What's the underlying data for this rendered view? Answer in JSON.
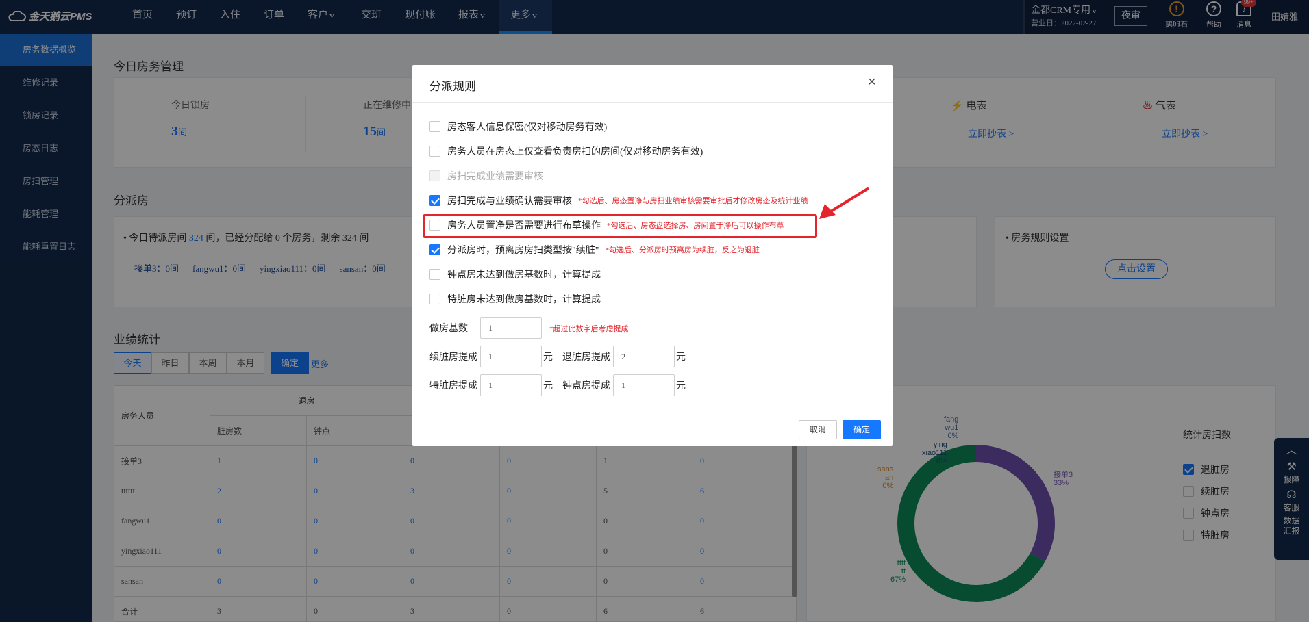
{
  "app": {
    "logo": "金天鹅云PMS"
  },
  "nav": [
    "首页",
    "预订",
    "入住",
    "订单",
    "客户",
    "交班",
    "现付账",
    "报表",
    "更多"
  ],
  "biz": {
    "store": "金都CRM专用",
    "date": "营业日：2022-02-27",
    "audit": "夜审",
    "icons": [
      {
        "label": "鹅卵石",
        "name": "warning-icon",
        "glyph": "!"
      },
      {
        "label": "帮助",
        "name": "help-icon",
        "glyph": "?"
      },
      {
        "label": "消息",
        "name": "bell-icon",
        "glyph": "♪"
      }
    ],
    "badge": "99+",
    "user": "田婧雅"
  },
  "sidebar": [
    "房务数据概览",
    "维修记录",
    "锁房记录",
    "房态日志",
    "房扫管理",
    "能耗管理",
    "能耗重置日志"
  ],
  "main": {
    "today_title": "今日房务管理",
    "kpi": [
      {
        "label": "今日锁房",
        "value": "3",
        "unit": "间"
      },
      {
        "label": "正在维修中",
        "value": "15",
        "unit": "间"
      }
    ],
    "meters": [
      {
        "label": "电表",
        "link": "立即抄表 >"
      },
      {
        "label": "气表",
        "link": "立即抄表 >"
      }
    ],
    "assign_title": "分派房",
    "assign_text": {
      "pre": "今日待派房间",
      "count": "324",
      "post": "间，已经分配给 0 个房务，剩余 324 间"
    },
    "staff": [
      "接单3：0间",
      "fangwu1：0间",
      "yingxiao111：0间",
      "sansan：0间"
    ],
    "rule_label": "房务规则设置",
    "rule_btn": "点击设置",
    "perf_title": "业绩统计",
    "tabs": [
      "今天",
      "昨日",
      "本周",
      "本月"
    ],
    "confirm": "确定",
    "more": "更多",
    "table": {
      "h_person": "房务人员",
      "h_group": "退房",
      "sub": [
        "脏房数",
        "钟点"
      ],
      "rows": [
        [
          "接单3",
          "1",
          "0",
          "0",
          "0",
          "1",
          "0"
        ],
        [
          "tttttt",
          "2",
          "0",
          "3",
          "0",
          "5",
          "6"
        ],
        [
          "fangwu1",
          "0",
          "0",
          "0",
          "0",
          "0",
          "0"
        ],
        [
          "yingxiao111",
          "0",
          "0",
          "0",
          "0",
          "0",
          "0"
        ],
        [
          "sansan",
          "0",
          "0",
          "0",
          "0",
          "0",
          "0"
        ],
        [
          "合计",
          "3",
          "0",
          "3",
          "0",
          "6",
          "6"
        ]
      ]
    },
    "legend_title": "统计房扫数",
    "legend": [
      {
        "label": "退脏房",
        "checked": true
      },
      {
        "label": "续脏房",
        "checked": false
      },
      {
        "label": "钟点房",
        "checked": false
      },
      {
        "label": "特脏房",
        "checked": false
      }
    ],
    "donut_labels": [
      {
        "text": "fang\nwu1\n0%",
        "color": "#4a6fa5"
      },
      {
        "text": "ying\nxiao111\n0%",
        "color": "#1f4e79"
      },
      {
        "text": "sans\nan\n0%",
        "color": "#d98b2b"
      },
      {
        "text": "接单3\n33%",
        "color": "#7a5cb8"
      },
      {
        "text": "tttt\ntt\n67%",
        "color": "#0e8a5a"
      }
    ]
  },
  "chart_data": {
    "type": "pie",
    "categories": [
      "接单3",
      "tttttt",
      "fangwu1",
      "yingxiao111",
      "sansan"
    ],
    "values": [
      33,
      67,
      0,
      0,
      0
    ],
    "colors": [
      "#6c4fae",
      "#0e8a5a",
      "#4a6fa5",
      "#1f4e79",
      "#d98b2b"
    ]
  },
  "floatbar": [
    "报障",
    "客服",
    "数据\n汇报"
  ],
  "modal": {
    "title": "分派规则",
    "close": "×",
    "options": [
      {
        "label": "房态客人信息保密(仅对移动房务有效)",
        "state": "off",
        "note": ""
      },
      {
        "label": "房务人员在房态上仅查看负责房扫的房间(仅对移动房务有效)",
        "state": "off",
        "note": ""
      },
      {
        "label": "房扫完成业绩需要审核",
        "state": "disabled",
        "note": ""
      },
      {
        "label": "房扫完成与业绩确认需要审核",
        "state": "on",
        "note": "*勾选后、房态置净与房扫业绩审核需要审批后才修改房态及统计业绩"
      },
      {
        "label": "房务人员置净是否需要进行布草操作",
        "state": "off",
        "note": "*勾选后、房态盘选择房、房间置于净后可以操作布草"
      },
      {
        "label": "分派房时，预离房房扫类型按\"续脏\"",
        "state": "on",
        "note": "*勾选后、分派房时预离房为续脏，反之为退脏"
      },
      {
        "label": "钟点房未达到做房基数时，计算提成",
        "state": "off",
        "note": ""
      },
      {
        "label": "特脏房未达到做房基数时，计算提成",
        "state": "off",
        "note": ""
      }
    ],
    "base_label": "做房基数",
    "base_value": "1",
    "base_note": "*超过此数字后考虑提成",
    "fields": [
      {
        "label": "续脏房提成",
        "value": "1"
      },
      {
        "label": "退脏房提成",
        "value": "2"
      },
      {
        "label": "特脏房提成",
        "value": "1"
      },
      {
        "label": "钟点房提成",
        "value": "1"
      }
    ],
    "unit": "元",
    "cancel": "取消",
    "ok": "确定"
  }
}
